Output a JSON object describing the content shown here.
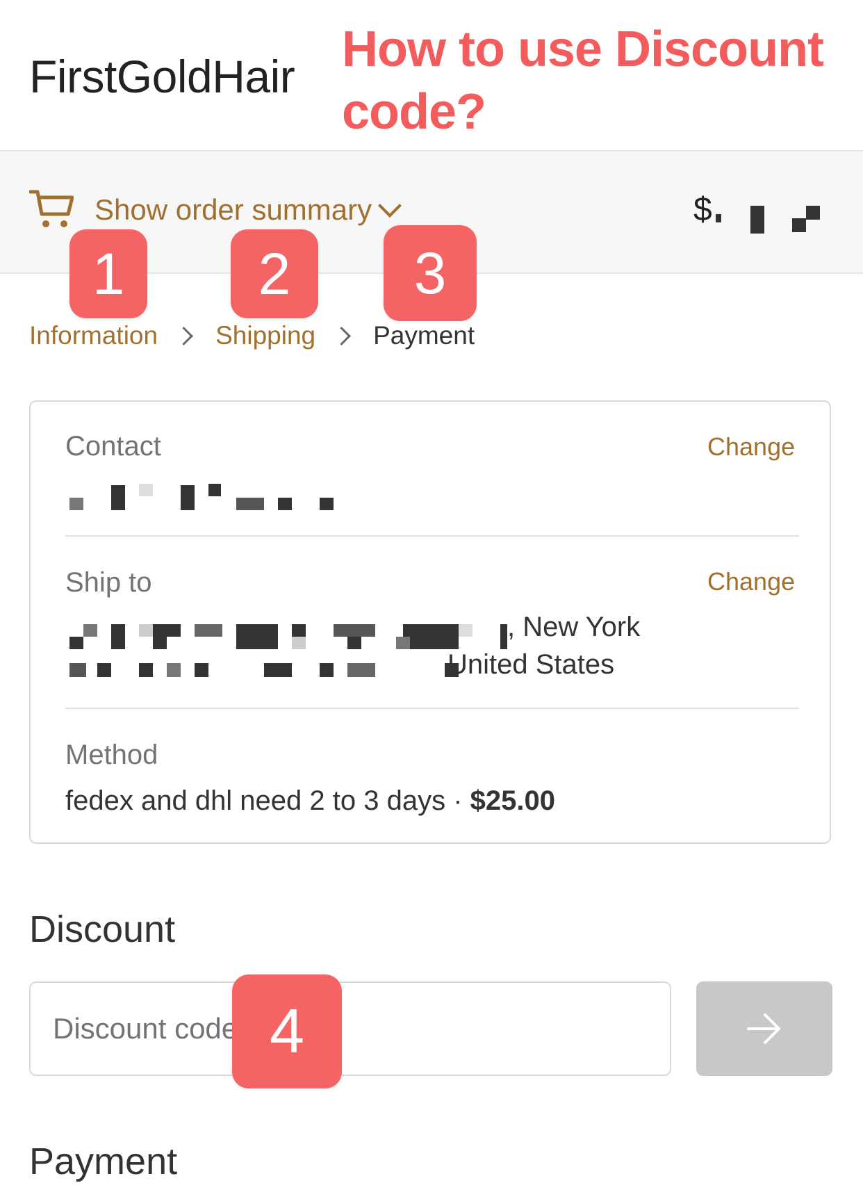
{
  "header": {
    "brand": "FirstGoldHair",
    "annotation_title": "How to use Discount code?"
  },
  "summary_bar": {
    "toggle_label": "Show order summary",
    "total_prefix": "$"
  },
  "badges": [
    "1",
    "2",
    "3",
    "4"
  ],
  "breadcrumb": {
    "items": [
      "Information",
      "Shipping",
      "Payment"
    ]
  },
  "review": {
    "contact": {
      "label": "Contact",
      "change": "Change"
    },
    "ship_to": {
      "label": "Ship to",
      "change": "Change",
      "city_state": ", New York",
      "country": "United States"
    },
    "method": {
      "label": "Method",
      "text": "fedex and dhl need 2 to 3 days · ",
      "price": "$25.00"
    }
  },
  "discount": {
    "title": "Discount",
    "placeholder": "Discount code"
  },
  "payment": {
    "title": "Payment"
  },
  "colors": {
    "accent": "#a0702f",
    "annotation": "#f56464",
    "apply_button": "#c8c8c8"
  },
  "icons": {
    "cart": "cart-icon",
    "chevron": "chevron-down-icon",
    "arrow": "arrow-right-icon"
  }
}
